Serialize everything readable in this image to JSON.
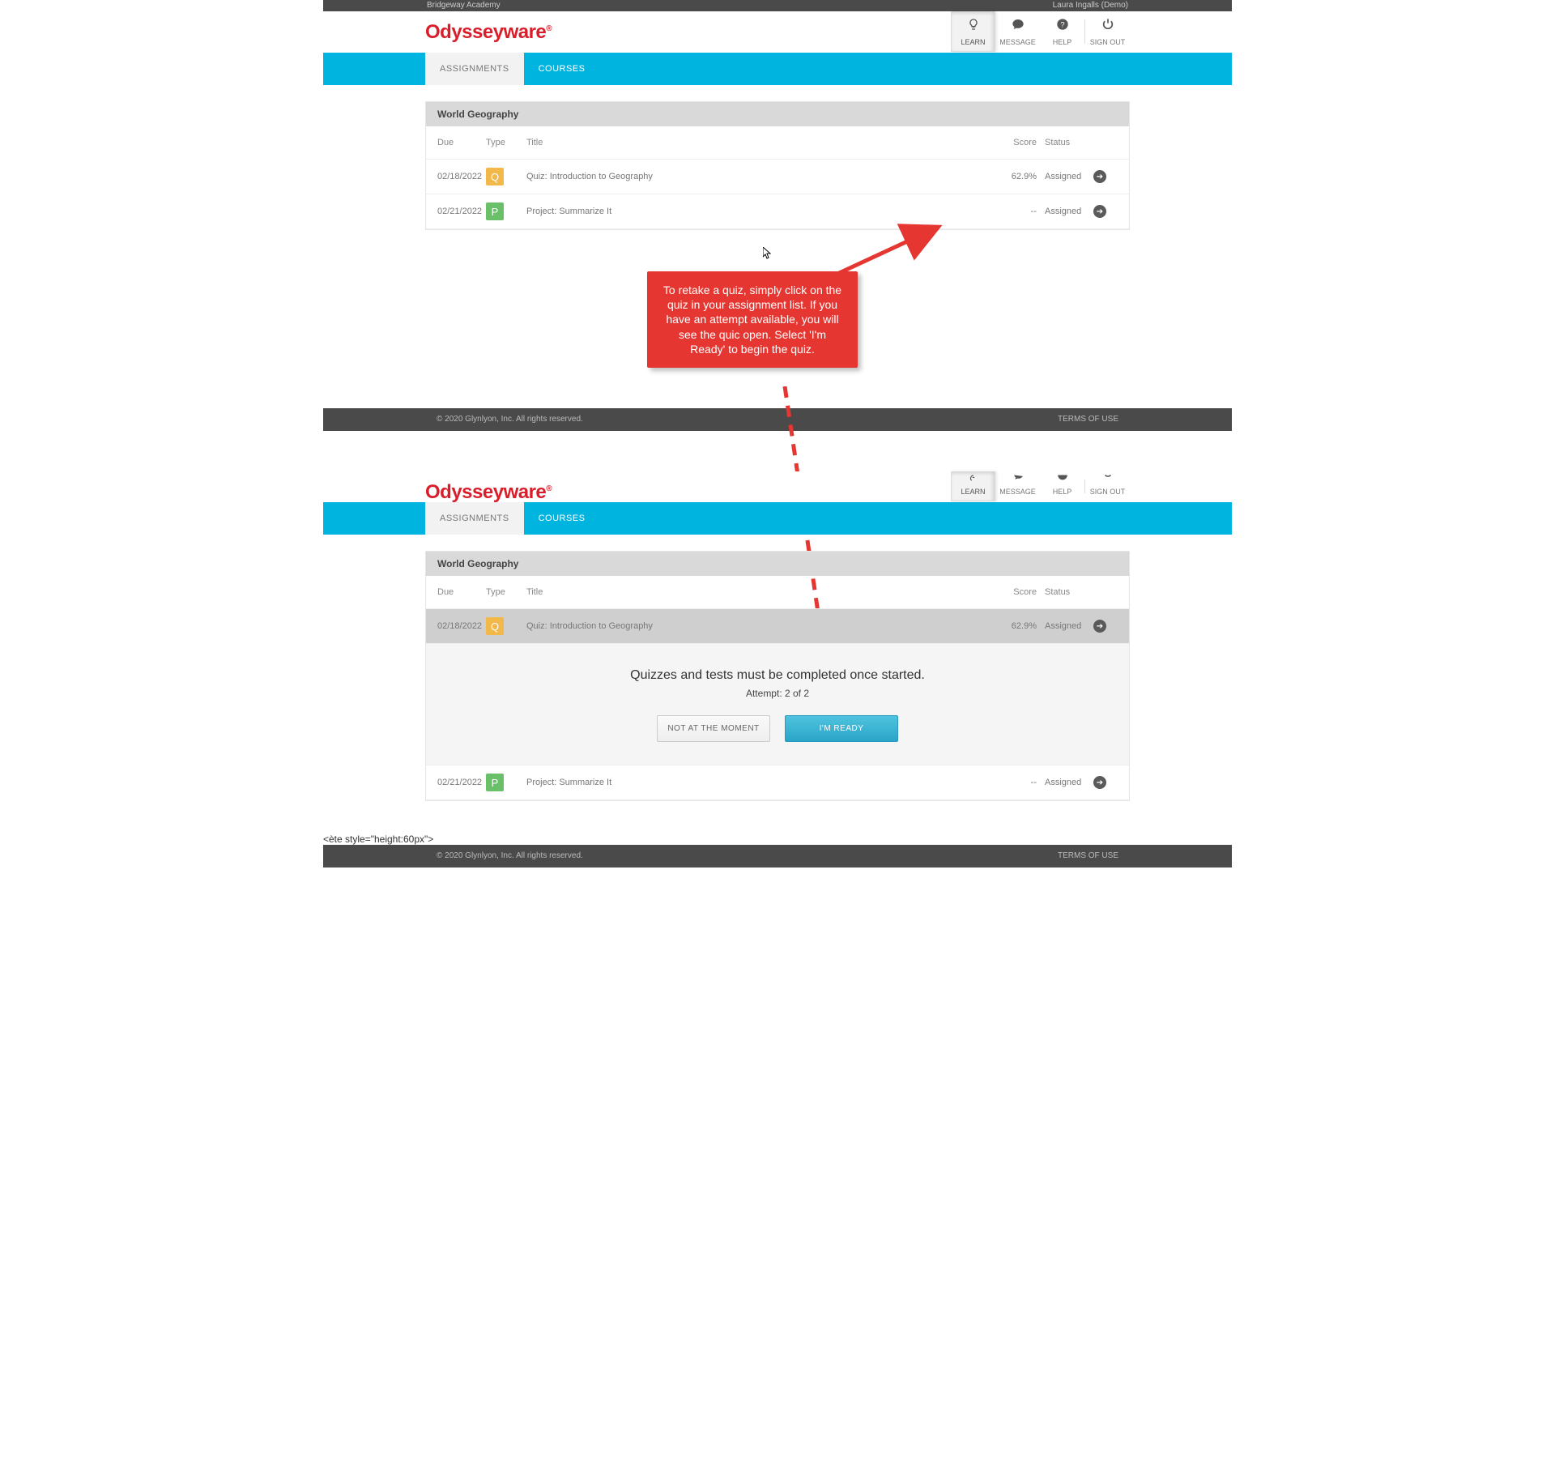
{
  "topbar": {
    "left": "Bridgeway Academy",
    "right": "Laura Ingalls (Demo)"
  },
  "brand": "Odysseyware",
  "brand_suffix": "®",
  "nav": [
    {
      "key": "learn",
      "label": "LEARN",
      "icon": "💡",
      "active": true
    },
    {
      "key": "message",
      "label": "MESSAGE",
      "icon": "💬",
      "active": false
    },
    {
      "key": "help",
      "label": "HELP",
      "icon": "?",
      "active": false
    },
    {
      "key": "signout",
      "label": "SIGN OUT",
      "icon": "⏻",
      "active": false
    }
  ],
  "tabs": [
    {
      "key": "assignments",
      "label": "ASSIGNMENTS",
      "active": true
    },
    {
      "key": "courses",
      "label": "COURSES",
      "active": false
    }
  ],
  "course_title": "World Geography",
  "columns": {
    "due": "Due",
    "type": "Type",
    "title": "Title",
    "score": "Score",
    "status": "Status"
  },
  "rows": [
    {
      "due": "02/18/2022",
      "badge": "Q",
      "badge_color": "q",
      "title": "Quiz: Introduction to Geography",
      "score": "62.9%",
      "status": "Assigned"
    },
    {
      "due": "02/21/2022",
      "badge": "P",
      "badge_color": "p",
      "title": "Project: Summarize It",
      "score": "--",
      "status": "Assigned"
    }
  ],
  "callout_text": "To retake a quiz, simply click on the quiz in your assignment list. If you have an attempt available, you will see the quic open. Select 'I'm Ready' to begin the quiz.",
  "footer": {
    "copyright": "© 2020 Glynlyon, Inc. All rights reserved.",
    "terms": "TERMS OF USE"
  },
  "expand": {
    "msg": "Quizzes and tests must be completed once started.",
    "sub_prefix": "Attempt: ",
    "sub_val": "2 of 2",
    "btn_no": "NOT AT THE MOMENT",
    "btn_yes": "I'M READY"
  }
}
